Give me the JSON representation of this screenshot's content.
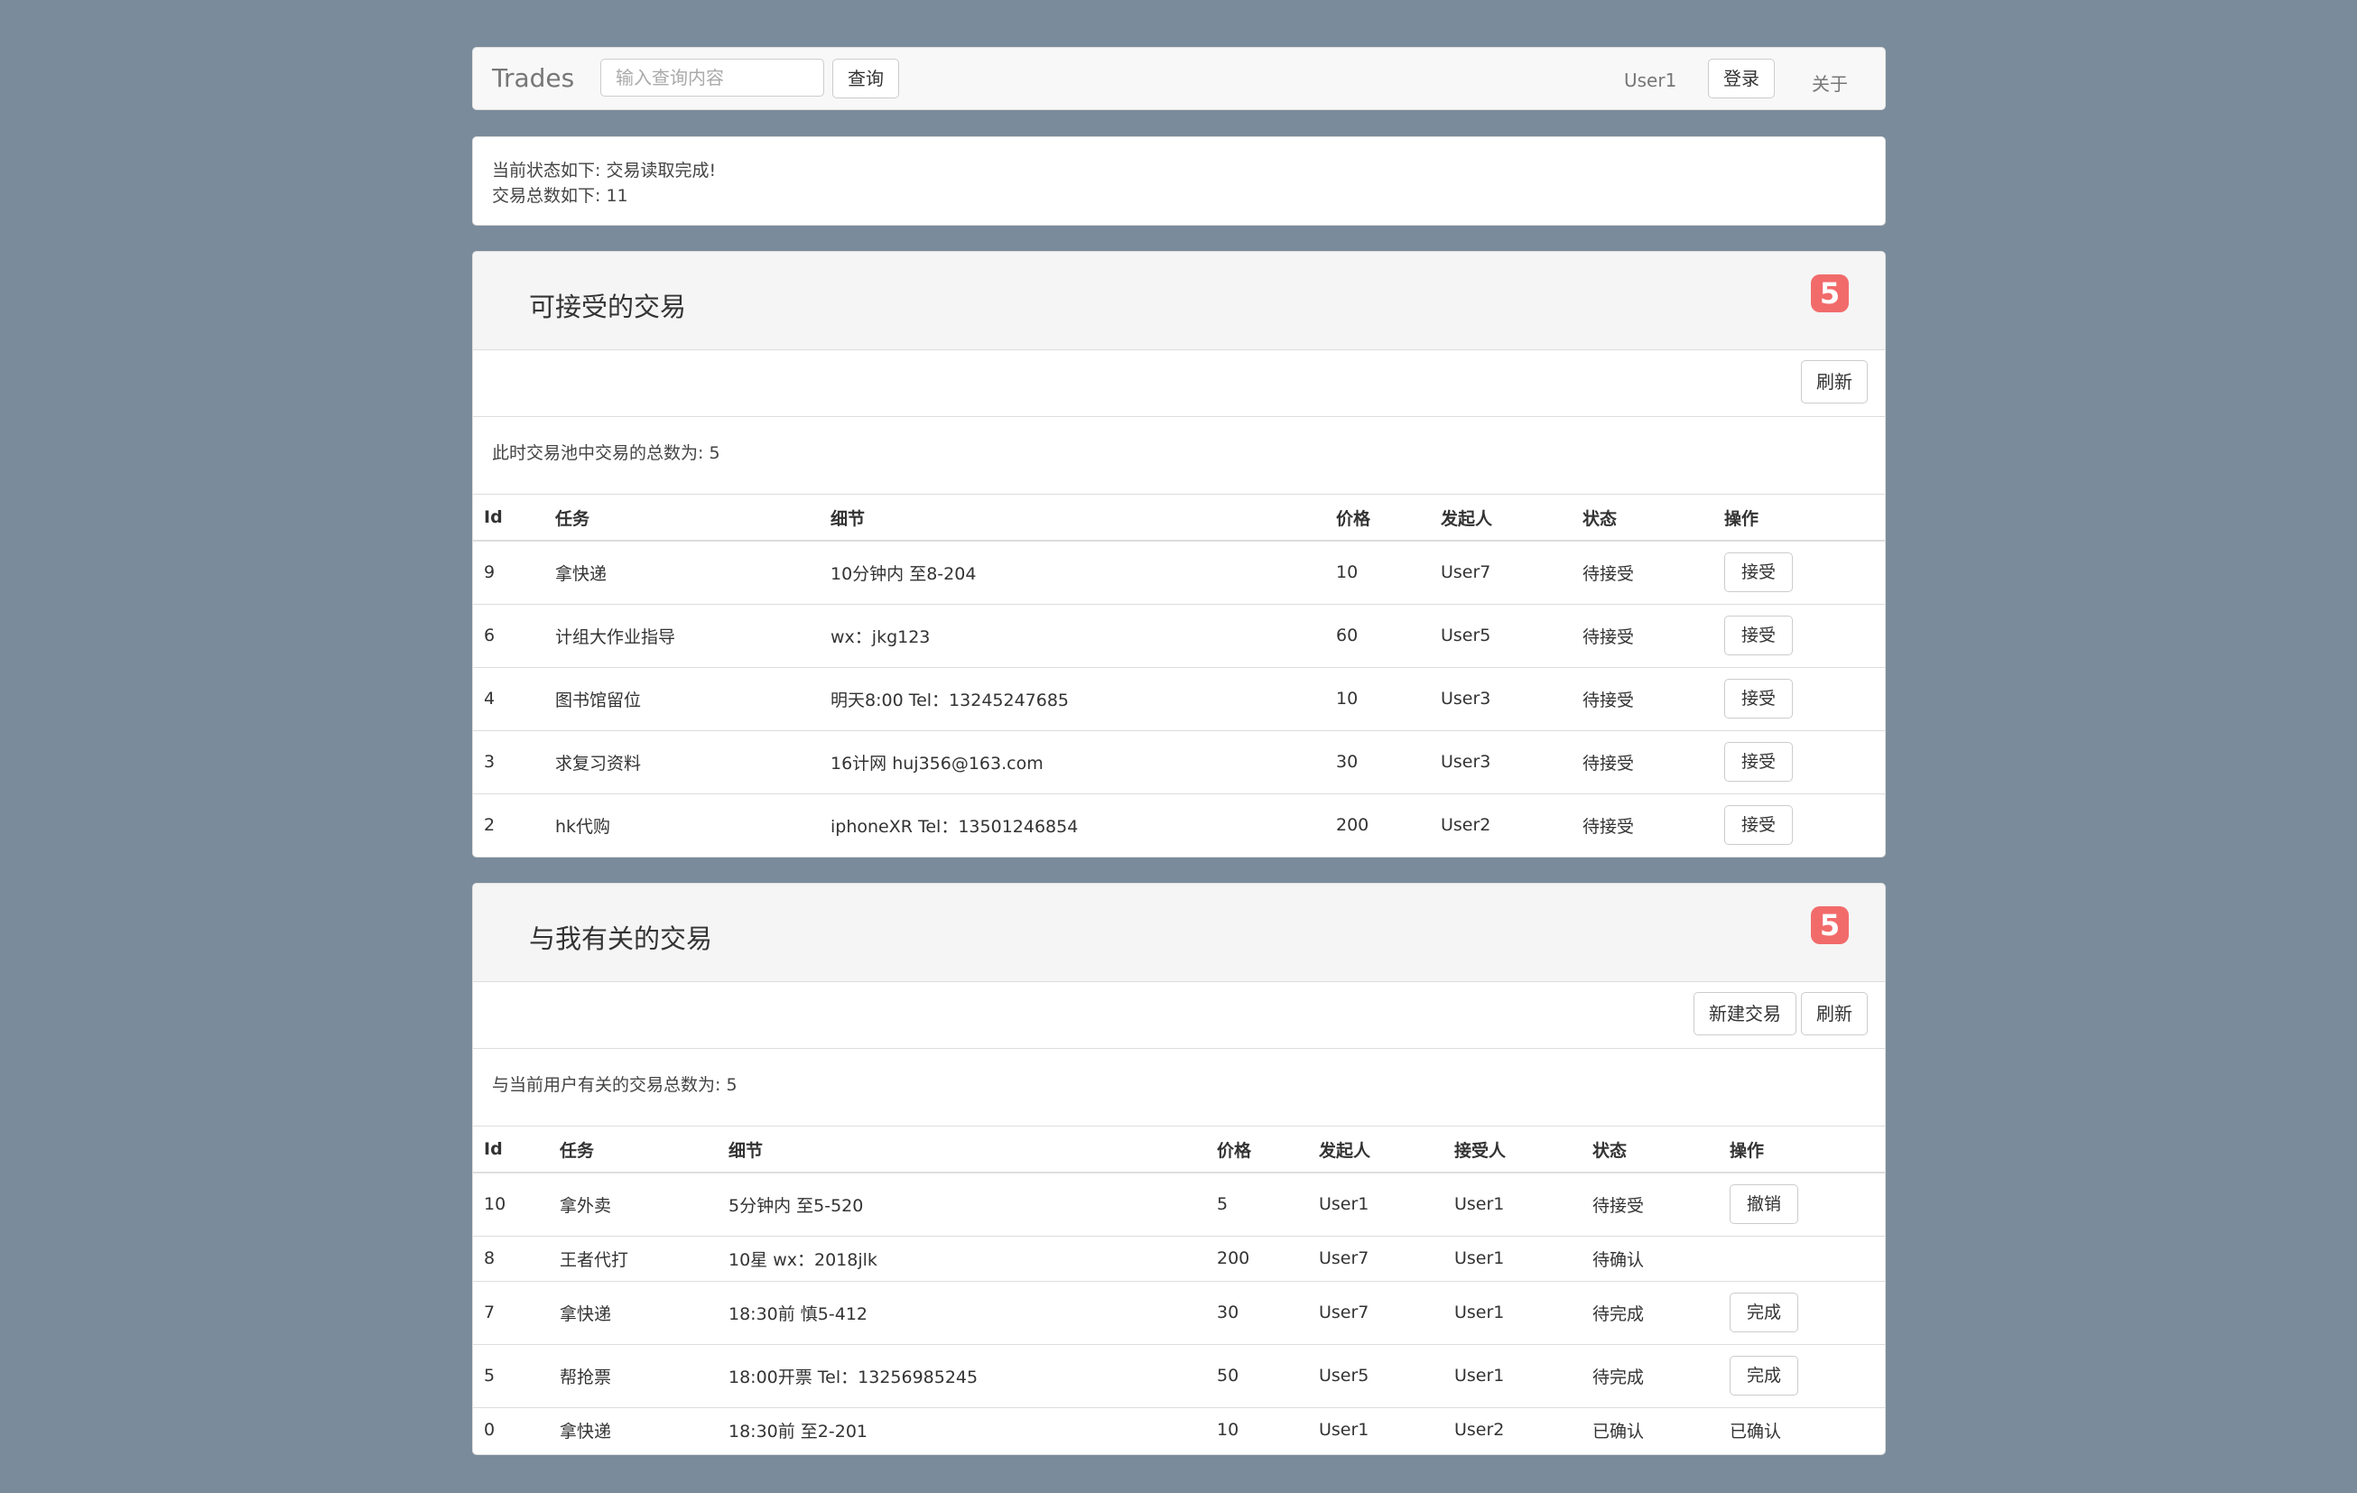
{
  "navbar": {
    "brand": "Trades",
    "search_placeholder": "输入查询内容",
    "search_button": "查询",
    "user": "User1",
    "login_button": "登录",
    "about_link": "关于"
  },
  "status": {
    "state_line": "当前状态如下: 交易读取完成!",
    "total_line": "交易总数如下: 11"
  },
  "available": {
    "title": "可接受的交易",
    "badge": "5",
    "refresh_button": "刷新",
    "count_text": "此时交易池中交易的总数为: 5",
    "columns": [
      "Id",
      "任务",
      "细节",
      "价格",
      "发起人",
      "状态",
      "操作"
    ],
    "rows": [
      {
        "id": "9",
        "task": "拿快递",
        "detail": "10分钟内 至8-204",
        "price": "10",
        "initiator": "User7",
        "state": "待接受",
        "action": "接受"
      },
      {
        "id": "6",
        "task": "计组大作业指导",
        "detail": "wx：jkg123",
        "price": "60",
        "initiator": "User5",
        "state": "待接受",
        "action": "接受"
      },
      {
        "id": "4",
        "task": "图书馆留位",
        "detail": "明天8:00 Tel：13245247685",
        "price": "10",
        "initiator": "User3",
        "state": "待接受",
        "action": "接受"
      },
      {
        "id": "3",
        "task": "求复习资料",
        "detail": "16计网 huj356@163.com",
        "price": "30",
        "initiator": "User3",
        "state": "待接受",
        "action": "接受"
      },
      {
        "id": "2",
        "task": "hk代购",
        "detail": "iphoneXR Tel：13501246854",
        "price": "200",
        "initiator": "User2",
        "state": "待接受",
        "action": "接受"
      }
    ]
  },
  "mine": {
    "title": "与我有关的交易",
    "badge": "5",
    "new_button": "新建交易",
    "refresh_button": "刷新",
    "count_text": "与当前用户有关的交易总数为: 5",
    "columns": [
      "Id",
      "任务",
      "细节",
      "价格",
      "发起人",
      "接受人",
      "状态",
      "操作"
    ],
    "rows": [
      {
        "id": "10",
        "task": "拿外卖",
        "detail": "5分钟内 至5-520",
        "price": "5",
        "initiator": "User1",
        "acceptor": "User1",
        "state": "待接受",
        "action": "撤销",
        "action_type": "button"
      },
      {
        "id": "8",
        "task": "王者代打",
        "detail": "10星 wx：2018jlk",
        "price": "200",
        "initiator": "User7",
        "acceptor": "User1",
        "state": "待确认",
        "action": "",
        "action_type": "none"
      },
      {
        "id": "7",
        "task": "拿快递",
        "detail": "18:30前 慎5-412",
        "price": "30",
        "initiator": "User7",
        "acceptor": "User1",
        "state": "待完成",
        "action": "完成",
        "action_type": "button"
      },
      {
        "id": "5",
        "task": "帮抢票",
        "detail": "18:00开票 Tel：13256985245",
        "price": "50",
        "initiator": "User5",
        "acceptor": "User1",
        "state": "待完成",
        "action": "完成",
        "action_type": "button"
      },
      {
        "id": "0",
        "task": "拿快递",
        "detail": "18:30前 至2-201",
        "price": "10",
        "initiator": "User1",
        "acceptor": "User2",
        "state": "已确认",
        "action": "已确认",
        "action_type": "text"
      }
    ]
  }
}
